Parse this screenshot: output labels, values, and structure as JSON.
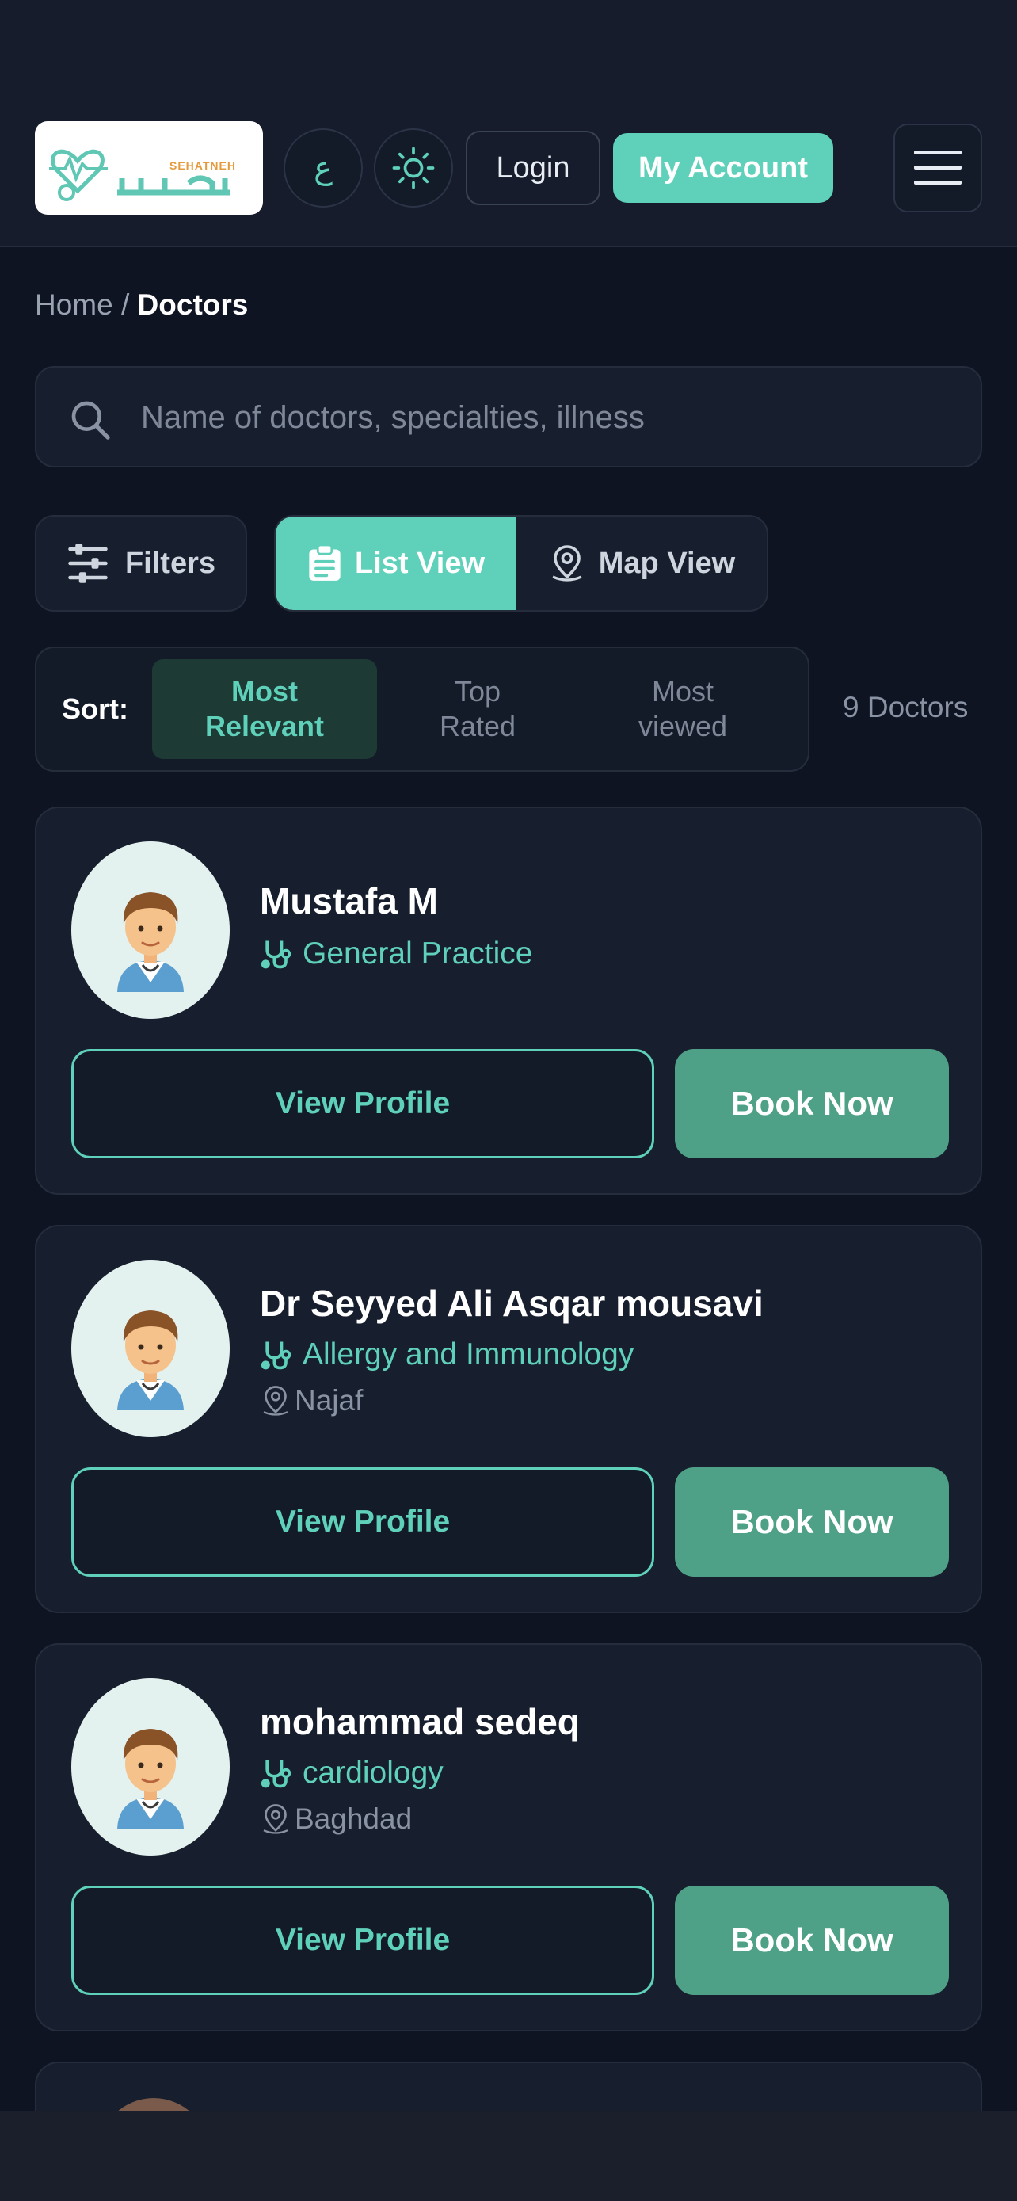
{
  "header": {
    "logo_text": "SEHATNEH",
    "lang_button": "ع",
    "login_label": "Login",
    "account_label": "My Account"
  },
  "breadcrumb": {
    "home": "Home",
    "separator": " / ",
    "current": "Doctors"
  },
  "search": {
    "placeholder": "Name of doctors, specialties, illness"
  },
  "toolbar": {
    "filters_label": "Filters",
    "list_view_label": "List View",
    "map_view_label": "Map View"
  },
  "sort": {
    "label": "Sort:",
    "options": [
      {
        "line1": "Most",
        "line2": "Relevant",
        "active": true
      },
      {
        "line1": "Top",
        "line2": "Rated",
        "active": false
      },
      {
        "line1": "Most",
        "line2": "viewed",
        "active": false
      }
    ],
    "count": "9 Doctors"
  },
  "doctors": [
    {
      "name": "Mustafa M",
      "specialty": "General Practice",
      "location": ""
    },
    {
      "name": "Dr Seyyed Ali Asqar mousavi",
      "specialty": "Allergy and Immunology",
      "location": "Najaf"
    },
    {
      "name": "mohammad sedeq",
      "specialty": "cardiology",
      "location": "Baghdad"
    }
  ],
  "card_actions": {
    "view_profile": "View Profile",
    "book_now": "Book Now"
  },
  "icons": {
    "lang": "arabic-letter-icon",
    "theme": "sun-icon",
    "menu": "hamburger-icon",
    "search": "search-icon",
    "filters": "sliders-icon",
    "list": "clipboard-icon",
    "map": "map-pin-icon",
    "specialty": "stethoscope-icon",
    "location": "location-pin-icon"
  },
  "colors": {
    "accent": "#5fd0b9",
    "book": "#4ea086",
    "background": "#0e1422",
    "card": "#171e2d"
  }
}
